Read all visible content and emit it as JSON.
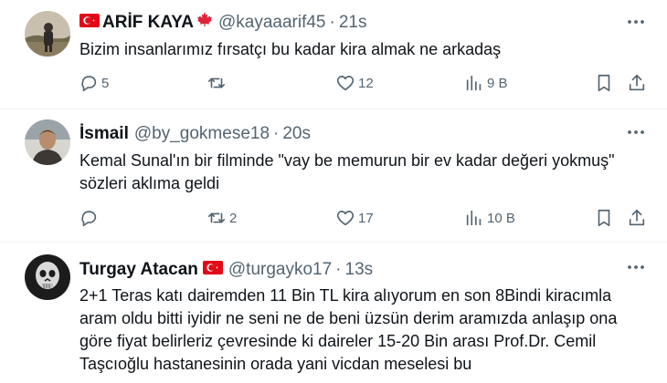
{
  "tweets": [
    {
      "name": "ARİF KAYA",
      "handle": "@kayaaarif45",
      "time": "21s",
      "text_lines": [
        "Bizim insanlarımız fırsatçı bu kadar kira almak ne arkadaş"
      ],
      "replies": "5",
      "retweets": "",
      "likes": "12",
      "views": "9 B"
    },
    {
      "name": "İsmail",
      "handle": "@by_gokmese18",
      "time": "20s",
      "text_lines": [
        "Kemal Sunal'ın bir filminde \"vay be memurun bir ev kadar değeri yokmuş\"",
        "sözleri aklıma geldi"
      ],
      "replies": "",
      "retweets": "2",
      "likes": "17",
      "views": "10 B"
    },
    {
      "name": "Turgay Atacan",
      "handle": "@turgayko17",
      "time": "13s",
      "text_lines": [
        "2+1 Teras katı dairemden 11 Bin TL kira alıyorum en son 8Bindi kiracımla",
        "aram oldu bitti iyidir ne seni ne de beni üzsün derim aramızda anlaşıp ona",
        "göre fiyat belirleriz çevresinde ki daireler 15-20 Bin arası Prof.Dr. Cemil",
        "Taşcıoğlu hastanesinin orada yani vicdan meselesi bu"
      ]
    }
  ],
  "sep": "·",
  "colors": {
    "text": "#0f1419",
    "muted": "#536471",
    "border": "#eff3f4",
    "flag_red": "#e30a17"
  },
  "icons": [
    "reply-icon",
    "retweet-icon",
    "like-icon",
    "views-icon",
    "bookmark-icon",
    "share-icon",
    "more-icon"
  ]
}
